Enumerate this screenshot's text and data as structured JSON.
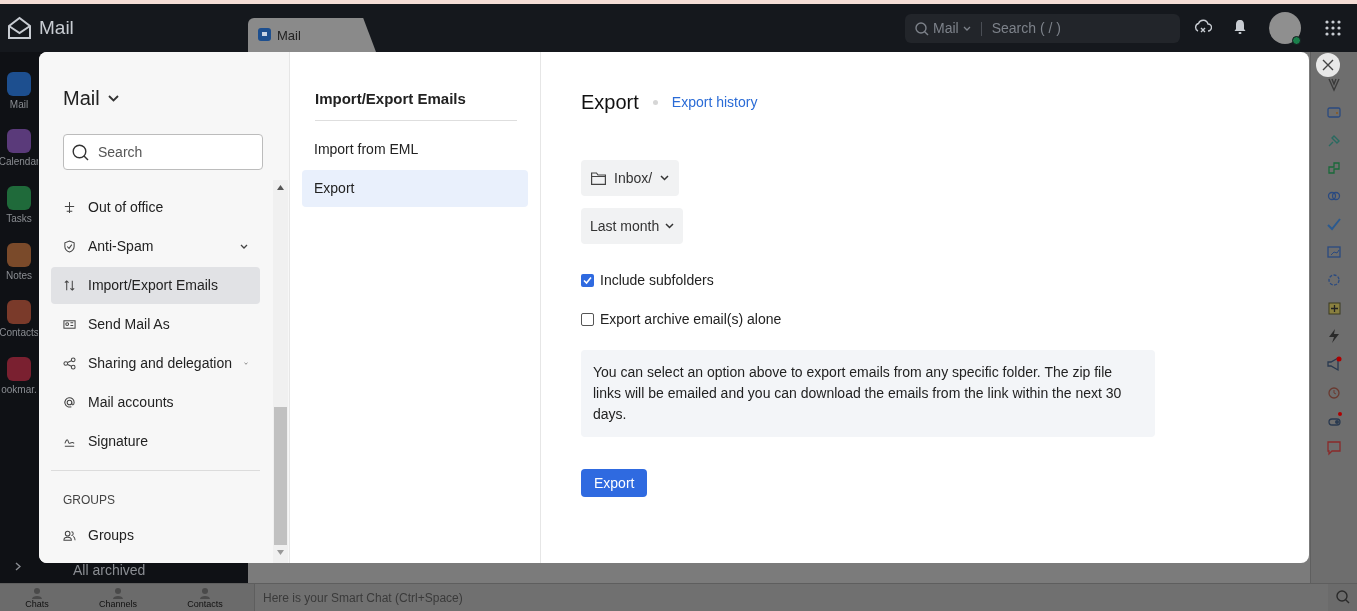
{
  "app_bar": {
    "logo": "Mail",
    "tab": "Mail",
    "search_scope": "Mail",
    "search_placeholder": "Search ( / )"
  },
  "app_rail": [
    {
      "label": "Mail",
      "color": "#1d4f8f"
    },
    {
      "label": "Calendar",
      "color": "#5a3a7a"
    },
    {
      "label": "Tasks",
      "color": "#1f6a3a"
    },
    {
      "label": "Notes",
      "color": "#7a4a2a"
    },
    {
      "label": "Contacts",
      "color": "#7a3a2a"
    },
    {
      "label": "ookmar.",
      "color": "#7a2030"
    }
  ],
  "background": {
    "folder_item": "All archived"
  },
  "bottom_bar": {
    "tabs": [
      "Chats",
      "Channels",
      "Contacts"
    ],
    "chat_placeholder": "Here is your Smart Chat (Ctrl+Space)"
  },
  "settings": {
    "title": "Mail",
    "search_placeholder": "Search",
    "items": [
      {
        "label": "Out of office",
        "expandable": false,
        "selected": false
      },
      {
        "label": "Anti-Spam",
        "expandable": true,
        "selected": false
      },
      {
        "label": "Import/Export Emails",
        "expandable": false,
        "selected": true
      },
      {
        "label": "Send Mail As",
        "expandable": false,
        "selected": false
      },
      {
        "label": "Sharing and delegation",
        "expandable": true,
        "selected": false
      },
      {
        "label": "Mail accounts",
        "expandable": false,
        "selected": false
      },
      {
        "label": "Signature",
        "expandable": false,
        "selected": false
      }
    ],
    "group_heading": "GROUPS",
    "group_items": [
      {
        "label": "Groups",
        "selected": false
      }
    ]
  },
  "section": {
    "title": "Import/Export Emails",
    "items": [
      {
        "label": "Import from EML",
        "selected": false
      },
      {
        "label": "Export",
        "selected": true
      }
    ]
  },
  "export": {
    "title": "Export",
    "history_link": "Export history",
    "folder": "Inbox/",
    "period": "Last month",
    "options": [
      {
        "label": "Include subfolders",
        "checked": true
      },
      {
        "label": "Export archive email(s) alone",
        "checked": false
      }
    ],
    "info": "You can select an option above to export emails from any specific folder. The zip file links will be emailed and you can download the emails from the link within the next 30 days.",
    "button": "Export"
  }
}
